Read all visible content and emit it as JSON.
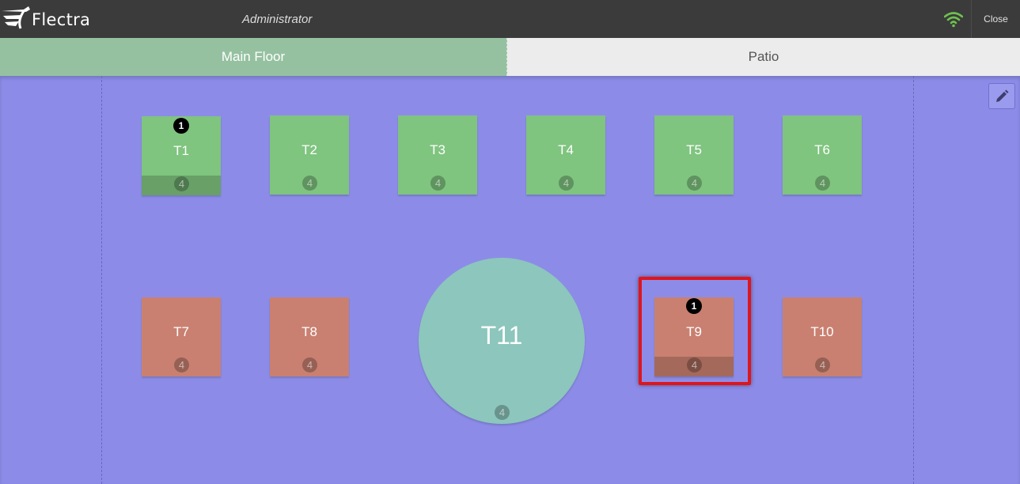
{
  "header": {
    "logo_text": "Flectra",
    "user_name": "Administrator",
    "close_label": "Close",
    "wifi_color": "#6ec14f"
  },
  "tabs": [
    {
      "label": "Main Floor",
      "active": true
    },
    {
      "label": "Patio",
      "active": false
    }
  ],
  "floor": {
    "background": "#8c8ce8",
    "edit_icon": "pencil-icon",
    "tables": [
      {
        "name": "T1",
        "seats": "4",
        "orders": "1",
        "color": "#7fc47f"
      },
      {
        "name": "T2",
        "seats": "4",
        "color": "#7fc47f"
      },
      {
        "name": "T3",
        "seats": "4",
        "color": "#7fc47f"
      },
      {
        "name": "T4",
        "seats": "4",
        "color": "#7fc47f"
      },
      {
        "name": "T5",
        "seats": "4",
        "color": "#7fc47f"
      },
      {
        "name": "T6",
        "seats": "4",
        "color": "#7fc47f"
      },
      {
        "name": "T7",
        "seats": "4",
        "color": "#c98070"
      },
      {
        "name": "T8",
        "seats": "4",
        "color": "#c98070"
      },
      {
        "name": "T11",
        "seats": "4",
        "color": "#8cc6bd",
        "shape": "round"
      },
      {
        "name": "T9",
        "seats": "4",
        "orders": "1",
        "color": "#c98070",
        "selected": true
      },
      {
        "name": "T10",
        "seats": "4",
        "color": "#c98070"
      }
    ]
  }
}
